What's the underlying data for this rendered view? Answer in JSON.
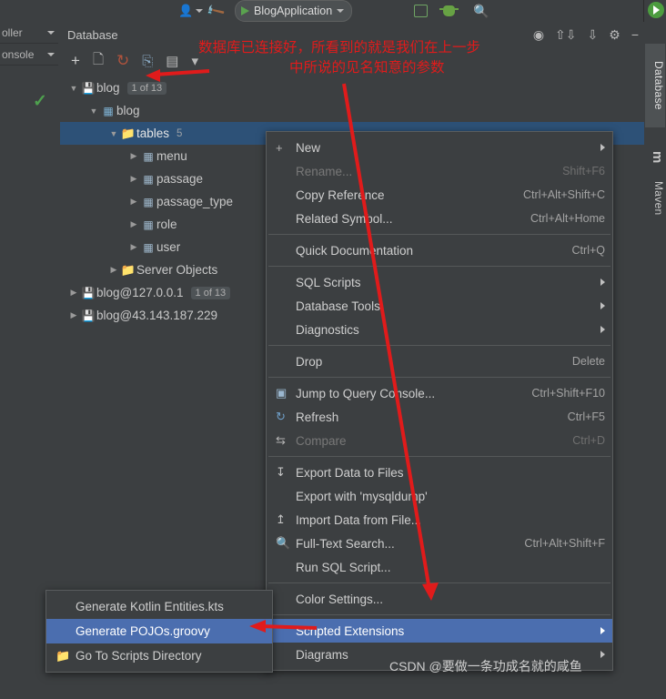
{
  "toolbar": {
    "person_icon": "person-icon",
    "person_dropdown": "chevron-down-icon",
    "hammer_icon": "build-hammer-icon",
    "run_config_name": "BlogApplication",
    "run_icon": "run-green-triangle-icon",
    "config_dropdown": "chevron-down-icon",
    "box_icon": "box-icon",
    "debug_icon": "debug-bug-icon",
    "search_icon": "search-icon"
  },
  "left_tabs": [
    {
      "label": "oller",
      "name": "sidebar-tab-controller"
    },
    {
      "label": "onsole",
      "name": "sidebar-tab-console"
    }
  ],
  "right_tabs": [
    {
      "label": "Database",
      "name": "tool-tab-database"
    },
    {
      "label": "m",
      "name": "tool-tab-maven-icon"
    },
    {
      "label": "Maven",
      "name": "tool-tab-maven"
    }
  ],
  "database_window": {
    "title": "Database",
    "header_icons": [
      "target-icon",
      "collapse-all-icon",
      "expand-all-icon",
      "settings-gear-icon",
      "hide-icon"
    ],
    "toolbar_icons": [
      "add-plus-icon",
      "copy-icon",
      "refresh-icon",
      "database-icon",
      "console-icon",
      "filter-icon"
    ],
    "tree": [
      {
        "indent": 0,
        "arrow": "v",
        "icon": "datasource",
        "label": "blog",
        "badge": "1 of 13",
        "selected": false,
        "name": "tree-node-blog-datasource"
      },
      {
        "indent": 1,
        "arrow": "v",
        "icon": "schema",
        "label": "blog",
        "badge": "",
        "selected": false,
        "name": "tree-node-blog-schema"
      },
      {
        "indent": 2,
        "arrow": "v",
        "icon": "folder",
        "label": "tables",
        "count": "5",
        "selected": true,
        "name": "tree-node-tables"
      },
      {
        "indent": 3,
        "arrow": ">",
        "icon": "table",
        "label": "menu",
        "selected": false,
        "name": "tree-node-table-menu"
      },
      {
        "indent": 3,
        "arrow": ">",
        "icon": "table",
        "label": "passage",
        "selected": false,
        "name": "tree-node-table-passage"
      },
      {
        "indent": 3,
        "arrow": ">",
        "icon": "table",
        "label": "passage_type",
        "selected": false,
        "name": "tree-node-table-passage-type"
      },
      {
        "indent": 3,
        "arrow": ">",
        "icon": "table",
        "label": "role",
        "selected": false,
        "name": "tree-node-table-role"
      },
      {
        "indent": 3,
        "arrow": ">",
        "icon": "table",
        "label": "user",
        "selected": false,
        "name": "tree-node-table-user"
      },
      {
        "indent": 2,
        "arrow": ">",
        "icon": "folder",
        "label": "Server Objects",
        "selected": false,
        "name": "tree-node-server-objects"
      },
      {
        "indent": 0,
        "arrow": ">",
        "icon": "datasource",
        "label": "blog@127.0.0.1",
        "badge": "1 of 13",
        "selected": false,
        "name": "tree-node-blog-127"
      },
      {
        "indent": 0,
        "arrow": ">",
        "icon": "datasource",
        "label": "blog@43.143.187.229",
        "badge": "",
        "selected": false,
        "name": "tree-node-blog-remote"
      }
    ]
  },
  "context_menu": {
    "items": [
      {
        "icon": "plus-icon",
        "label": "New",
        "shortcut": "",
        "submenu": true,
        "disabled": false,
        "highlight": false,
        "name": "ctx-new"
      },
      {
        "icon": "",
        "label": "Rename...",
        "shortcut": "Shift+F6",
        "submenu": false,
        "disabled": true,
        "highlight": false,
        "name": "ctx-rename"
      },
      {
        "icon": "",
        "label": "Copy Reference",
        "shortcut": "Ctrl+Alt+Shift+C",
        "submenu": false,
        "disabled": false,
        "highlight": false,
        "name": "ctx-copy-reference"
      },
      {
        "icon": "",
        "label": "Related Symbol...",
        "shortcut": "Ctrl+Alt+Home",
        "submenu": false,
        "disabled": false,
        "highlight": false,
        "name": "ctx-related-symbol"
      },
      {
        "separator": true
      },
      {
        "icon": "",
        "label": "Quick Documentation",
        "shortcut": "Ctrl+Q",
        "submenu": false,
        "disabled": false,
        "highlight": false,
        "name": "ctx-quick-documentation"
      },
      {
        "separator": true
      },
      {
        "icon": "",
        "label": "SQL Scripts",
        "shortcut": "",
        "submenu": true,
        "disabled": false,
        "highlight": false,
        "name": "ctx-sql-scripts"
      },
      {
        "icon": "",
        "label": "Database Tools",
        "shortcut": "",
        "submenu": true,
        "disabled": false,
        "highlight": false,
        "name": "ctx-database-tools"
      },
      {
        "icon": "",
        "label": "Diagnostics",
        "shortcut": "",
        "submenu": true,
        "disabled": false,
        "highlight": false,
        "name": "ctx-diagnostics"
      },
      {
        "separator": true
      },
      {
        "icon": "",
        "label": "Drop",
        "shortcut": "Delete",
        "submenu": false,
        "disabled": false,
        "highlight": false,
        "name": "ctx-drop"
      },
      {
        "separator": true
      },
      {
        "icon": "console-icon",
        "label": "Jump to Query Console...",
        "shortcut": "Ctrl+Shift+F10",
        "submenu": false,
        "disabled": false,
        "highlight": false,
        "name": "ctx-jump-to-query-console"
      },
      {
        "icon": "refresh-icon",
        "label": "Refresh",
        "shortcut": "Ctrl+F5",
        "submenu": false,
        "disabled": false,
        "highlight": false,
        "name": "ctx-refresh"
      },
      {
        "icon": "compare-icon",
        "label": "Compare",
        "shortcut": "Ctrl+D",
        "submenu": false,
        "disabled": true,
        "highlight": false,
        "name": "ctx-compare"
      },
      {
        "separator": true
      },
      {
        "icon": "export-icon",
        "label": "Export Data to Files",
        "shortcut": "",
        "submenu": false,
        "disabled": false,
        "highlight": false,
        "name": "ctx-export-data-to-files"
      },
      {
        "icon": "",
        "label": "Export with 'mysqldump'",
        "shortcut": "",
        "submenu": false,
        "disabled": false,
        "highlight": false,
        "name": "ctx-export-with-mysqldump"
      },
      {
        "icon": "import-icon",
        "label": "Import Data from File...",
        "shortcut": "",
        "submenu": false,
        "disabled": false,
        "highlight": false,
        "name": "ctx-import-data-from-file"
      },
      {
        "icon": "search-icon",
        "label": "Full-Text Search...",
        "shortcut": "Ctrl+Alt+Shift+F",
        "submenu": false,
        "disabled": false,
        "highlight": false,
        "name": "ctx-full-text-search"
      },
      {
        "icon": "",
        "label": "Run SQL Script...",
        "shortcut": "",
        "submenu": false,
        "disabled": false,
        "highlight": false,
        "name": "ctx-run-sql-script"
      },
      {
        "separator": true
      },
      {
        "icon": "",
        "label": "Color Settings...",
        "shortcut": "",
        "submenu": false,
        "disabled": false,
        "highlight": false,
        "name": "ctx-color-settings"
      },
      {
        "separator": true
      },
      {
        "icon": "",
        "label": "Scripted Extensions",
        "shortcut": "",
        "submenu": true,
        "disabled": false,
        "highlight": true,
        "name": "ctx-scripted-extensions"
      },
      {
        "icon": "",
        "label": "Diagrams",
        "shortcut": "",
        "submenu": true,
        "disabled": false,
        "highlight": false,
        "name": "ctx-diagrams"
      }
    ]
  },
  "submenu": {
    "items": [
      {
        "icon": "",
        "label": "Generate Kotlin Entities.kts",
        "highlight": false,
        "name": "submenu-generate-kotlin-entities"
      },
      {
        "icon": "",
        "label": "Generate POJOs.groovy",
        "highlight": true,
        "name": "submenu-generate-pojos-groovy"
      },
      {
        "icon": "folder-icon",
        "label": "Go To Scripts Directory",
        "highlight": false,
        "name": "submenu-go-to-scripts-directory"
      }
    ]
  },
  "annotations": {
    "line1": "数据库已连接好，所看到的就是我们在上一步",
    "line2": "中所说的见名知意的参数",
    "color": "#e01b1b"
  },
  "watermark": {
    "text": "CSDN @要做一条功成名就的咸鱼"
  }
}
